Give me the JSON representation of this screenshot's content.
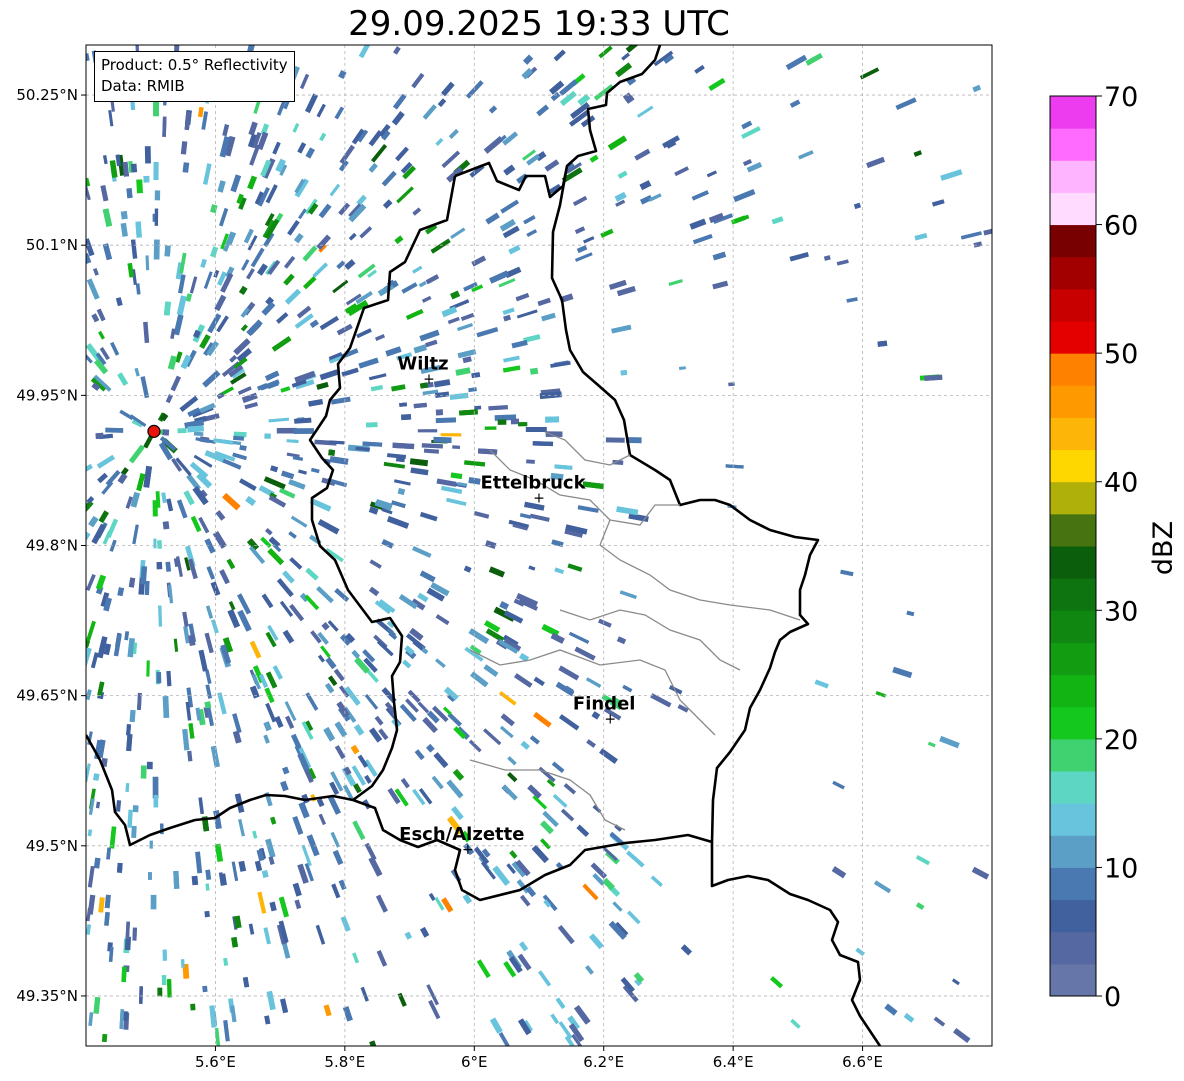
{
  "title": "29.09.2025 19:33 UTC",
  "info": {
    "product": "Product: 0.5° Reflectivity",
    "data": "Data: RMIB"
  },
  "map": {
    "lon_range": [
      5.4,
      6.8
    ],
    "lat_range": [
      49.3,
      50.3
    ],
    "lon_ticks": [
      {
        "value": 5.6,
        "label": "5.6°E"
      },
      {
        "value": 5.8,
        "label": "5.8°E"
      },
      {
        "value": 6.0,
        "label": "6°E"
      },
      {
        "value": 6.2,
        "label": "6.2°E"
      },
      {
        "value": 6.4,
        "label": "6.4°E"
      },
      {
        "value": 6.6,
        "label": "6.6°E"
      }
    ],
    "lat_ticks": [
      {
        "value": 49.35,
        "label": "49.35°N"
      },
      {
        "value": 49.5,
        "label": "49.5°N"
      },
      {
        "value": 49.65,
        "label": "49.65°N"
      },
      {
        "value": 49.8,
        "label": "49.8°N"
      },
      {
        "value": 49.95,
        "label": "49.95°N"
      },
      {
        "value": 50.1,
        "label": "50.1°N"
      },
      {
        "value": 50.25,
        "label": "50.25°N"
      }
    ],
    "grid": true,
    "radar_site": {
      "lon": 5.505,
      "lat": 49.914,
      "color": "#e8140c"
    },
    "cities": [
      {
        "name": "Wiltz",
        "lon": 5.93,
        "lat": 49.966
      },
      {
        "name": "Ettelbruck",
        "lon": 6.1,
        "lat": 49.847
      },
      {
        "name": "Findel",
        "lon": 6.21,
        "lat": 49.626
      },
      {
        "name": "Esch/Alzette",
        "lon": 5.99,
        "lat": 49.496
      }
    ]
  },
  "colorbar": {
    "label": "dBZ",
    "min": 0,
    "max": 70,
    "step": 2.5,
    "tick_values": [
      0,
      10,
      20,
      30,
      40,
      50,
      60,
      70
    ],
    "tick_labels": [
      "0",
      "10",
      "20",
      "30",
      "40",
      "50",
      "60",
      "70"
    ],
    "colors": [
      "#6676a8",
      "#5568a2",
      "#41609e",
      "#4a78b0",
      "#5b9ec6",
      "#68c4dc",
      "#5ed6c4",
      "#40d270",
      "#14c81e",
      "#12b414",
      "#119c12",
      "#0f8711",
      "#0e7410",
      "#0b5e0c",
      "#477410",
      "#afb00a",
      "#ffd700",
      "#fdb508",
      "#ff9900",
      "#ff8100",
      "#e50000",
      "#c80000",
      "#a20000",
      "#780000",
      "#ffdcff",
      "#ffb4ff",
      "#ff6aff",
      "#ed3cef"
    ]
  }
}
